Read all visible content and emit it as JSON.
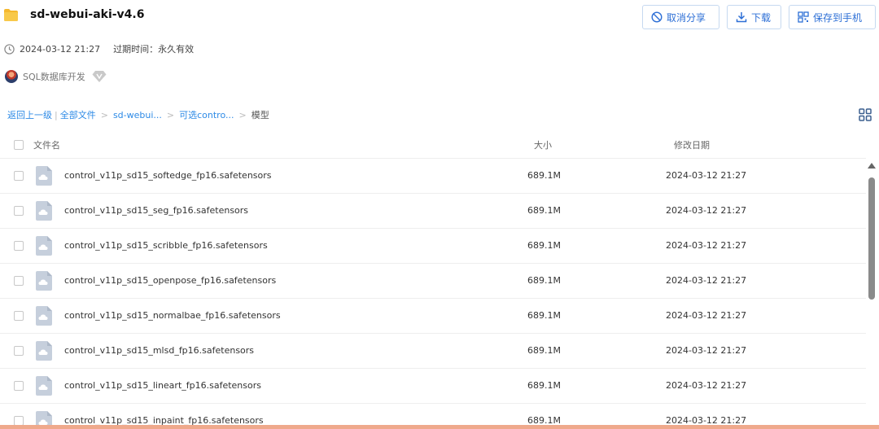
{
  "colors": {
    "accent": "#2d6fd6",
    "link": "#2d8ae6",
    "folder": "#f5b82e",
    "file_icon": "#c6cfdc",
    "bottom_strip": "#efa98c"
  },
  "header": {
    "title": "sd-webui-aki-v4.6",
    "created": "2024-03-12 21:27",
    "expire": "过期时间：永久有效",
    "owner": "SQL数据库开发",
    "actions": {
      "cancel_share": "取消分享",
      "download": "下载",
      "save_to_phone": "保存到手机"
    }
  },
  "breadcrumb": {
    "back": "返回上一级",
    "all_files": "全部文件",
    "level1": "sd-webui...",
    "level2": "可选contro...",
    "current": "模型"
  },
  "table": {
    "columns": {
      "name": "文件名",
      "size": "大小",
      "date": "修改日期"
    },
    "rows": [
      {
        "name": "control_v11p_sd15_softedge_fp16.safetensors",
        "size": "689.1M",
        "date": "2024-03-12 21:27"
      },
      {
        "name": "control_v11p_sd15_seg_fp16.safetensors",
        "size": "689.1M",
        "date": "2024-03-12 21:27"
      },
      {
        "name": "control_v11p_sd15_scribble_fp16.safetensors",
        "size": "689.1M",
        "date": "2024-03-12 21:27"
      },
      {
        "name": "control_v11p_sd15_openpose_fp16.safetensors",
        "size": "689.1M",
        "date": "2024-03-12 21:27"
      },
      {
        "name": "control_v11p_sd15_normalbae_fp16.safetensors",
        "size": "689.1M",
        "date": "2024-03-12 21:27"
      },
      {
        "name": "control_v11p_sd15_mlsd_fp16.safetensors",
        "size": "689.1M",
        "date": "2024-03-12 21:27"
      },
      {
        "name": "control_v11p_sd15_lineart_fp16.safetensors",
        "size": "689.1M",
        "date": "2024-03-12 21:27"
      },
      {
        "name": "control_v11p_sd15_inpaint_fp16.safetensors",
        "size": "689.1M",
        "date": "2024-03-12 21:27"
      }
    ]
  },
  "icons": {
    "folder": "folder-icon",
    "clock": "clock-icon",
    "vip": "diamond-vip-icon",
    "cancel": "no-share-icon",
    "download": "download-icon",
    "save": "qr-code-icon",
    "grid": "grid-view-icon",
    "file": "cloud-file-icon"
  }
}
